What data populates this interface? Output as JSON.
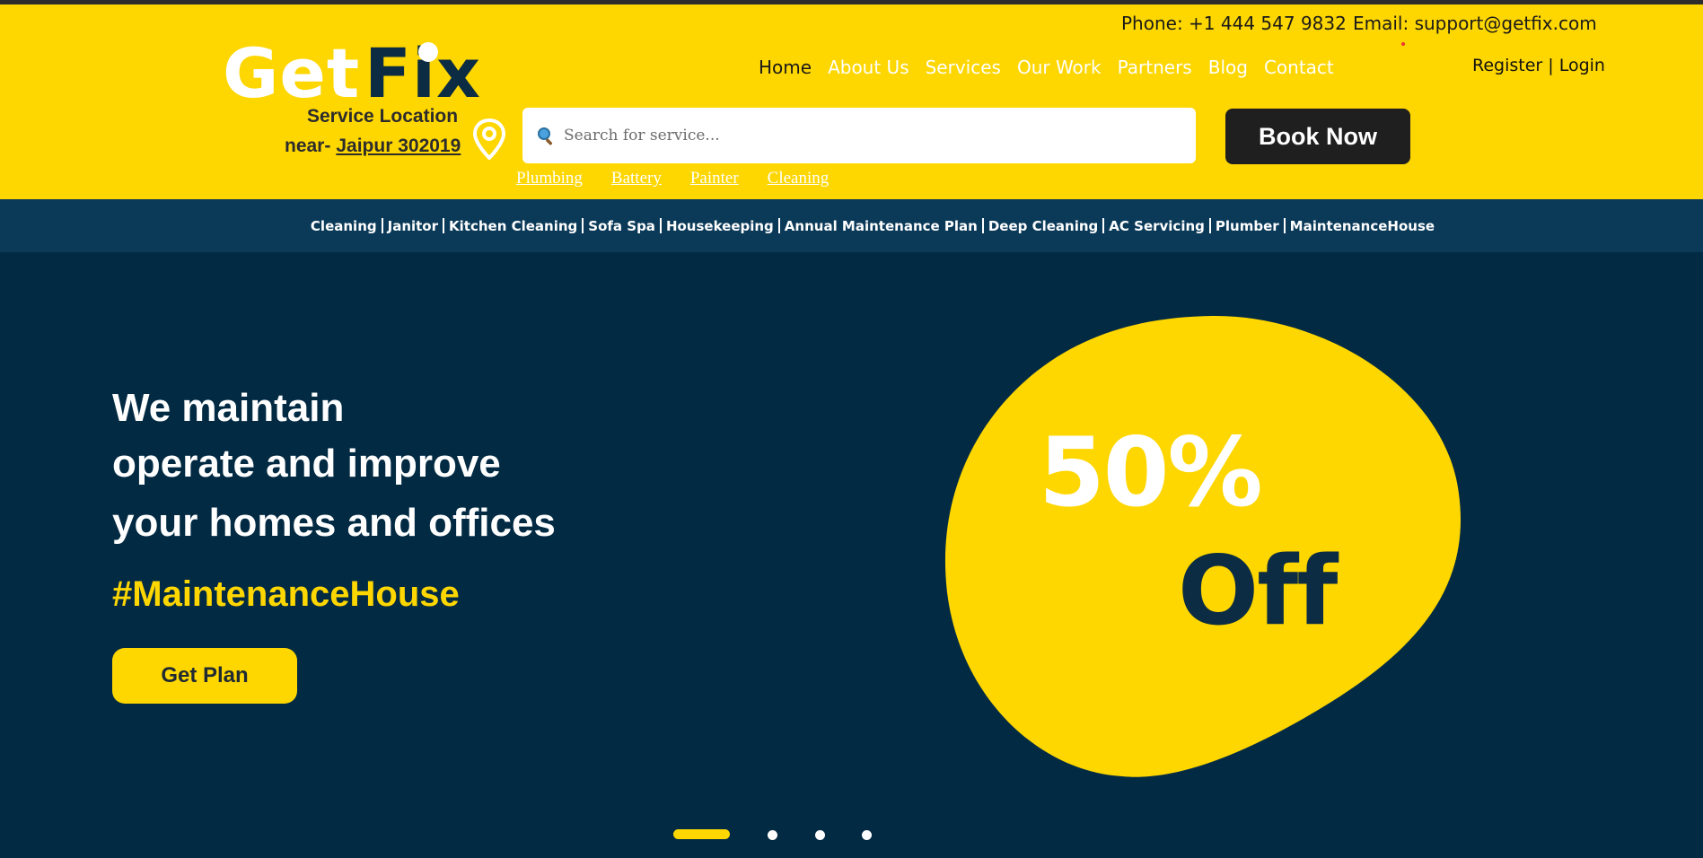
{
  "header": {
    "phone": "Phone: +1 444 547 9832",
    "email": "Email: support@getfix.com",
    "logo": {
      "part1": "Get",
      "part2": "Fix"
    },
    "nav": [
      "Home",
      "About Us",
      "Services",
      "Our Work",
      "Partners",
      "Blog",
      "Contact"
    ],
    "auth": {
      "register": "Register",
      "separator": " | ",
      "login": "Login"
    },
    "location": {
      "label": "Service Location",
      "near": "near-",
      "city": "Jaipur 302019"
    },
    "search": {
      "placeholder": "Search for service...",
      "value": ""
    },
    "book_button": "Book Now",
    "quick_links": [
      "Plumbing",
      "Battery",
      "Painter",
      "Cleaning"
    ]
  },
  "categories": [
    "Cleaning",
    "Janitor",
    "Kitchen Cleaning",
    "Sofa Spa",
    "Housekeeping",
    "Annual Maintenance Plan",
    "Deep Cleaning",
    "AC Servicing",
    "Plumber",
    "MaintenanceHouse"
  ],
  "hero": {
    "line1": "We maintain",
    "line2": "operate and improve",
    "line3": "your homes and offices",
    "hashtag": "#MaintenanceHouse",
    "cta": "Get Plan",
    "promo": {
      "percent": "50%",
      "off": "Off"
    }
  },
  "carousel": {
    "slides": 4,
    "active": 1
  },
  "colors": {
    "yellow": "#fed600",
    "navy": "#022a43",
    "catbar": "#0b3a59",
    "dark_button": "#1f1f1f"
  }
}
